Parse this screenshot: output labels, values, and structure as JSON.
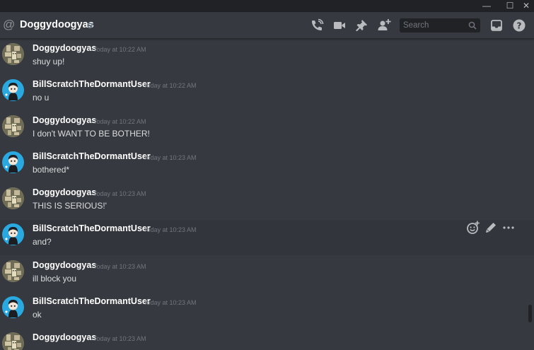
{
  "window": {
    "minimize_glyph": "—",
    "maximize_glyph": "☐",
    "close_glyph": "✕"
  },
  "header": {
    "at_glyph": "@",
    "title": "Doggydoogyas",
    "status": "offline",
    "icons": [
      "call-icon",
      "video-icon",
      "pin-icon",
      "add-friend-icon",
      "inbox-icon",
      "help-icon"
    ],
    "search_placeholder": "Search"
  },
  "colors": {
    "background": "#36393f",
    "titlebar": "#202225",
    "username": "#ffffff",
    "timestamp": "#72767d",
    "message_text": "#dcddde",
    "hover_row": "#32353b",
    "avatar_blue": "#2aa9e0"
  },
  "messages": [
    {
      "author": "Doggydoogyas",
      "time": "Today at 10:22 AM",
      "text": "shuy up!",
      "avatar": "doggy-avatar"
    },
    {
      "author": "BillScratchTheDormantUser",
      "time": "Today at 10:22 AM",
      "text": "no u",
      "avatar": "bill-avatar"
    },
    {
      "author": "Doggydoogyas",
      "time": "Today at 10:22 AM",
      "text": "I don't WANT TO BE BOTHER!",
      "avatar": "doggy-avatar"
    },
    {
      "author": "BillScratchTheDormantUser",
      "time": "Today at 10:23 AM",
      "text": "bothered*",
      "avatar": "bill-avatar"
    },
    {
      "author": "Doggydoogyas",
      "time": "Today at 10:23 AM",
      "text": "THIS IS SERIOUS!'",
      "avatar": "doggy-avatar"
    },
    {
      "author": "BillScratchTheDormantUser",
      "time": "Today at 10:23 AM",
      "text": "and?",
      "avatar": "bill-avatar"
    },
    {
      "author": "Doggydoogyas",
      "time": "Today at 10:23 AM",
      "text": "ill block you",
      "avatar": "doggy-avatar"
    },
    {
      "author": "BillScratchTheDormantUser",
      "time": "Today at 10:23 AM",
      "text": "ok",
      "avatar": "bill-avatar"
    },
    {
      "author": "Doggydoogyas",
      "time": "Today at 10:23 AM",
      "text": "",
      "avatar": "doggy-avatar"
    }
  ],
  "message_actions": [
    "add-reaction-icon",
    "edit-icon",
    "more-options-icon"
  ]
}
